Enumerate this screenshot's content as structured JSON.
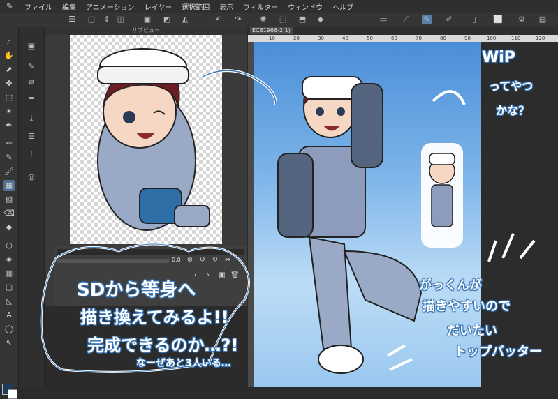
{
  "menu": {
    "logo_icon": "clip-studio-logo-icon",
    "items": [
      "ファイル",
      "編集",
      "アニメーション",
      "レイヤー",
      "選択範囲",
      "表示",
      "フィルター",
      "ウィンドウ",
      "ヘルプ"
    ]
  },
  "subview": {
    "title": "サブビュー",
    "zoom": "0.0"
  },
  "canvas": {
    "tab_label": "EC61966-2.1)",
    "ruler_ticks": [
      "10",
      "20",
      "30",
      "40",
      "50",
      "60",
      "70",
      "80",
      "90",
      "100",
      "110",
      "120"
    ]
  },
  "annotations": {
    "wip": "WiP",
    "wip_q1": "ってやつ",
    "wip_q2": "かな？",
    "left_1": "SDから等身へ",
    "left_2": "描き換えてみるよ!!",
    "left_3": "完成できるのか…?!",
    "left_4": "なーぜあと3人いる…",
    "right_1": "がっくんが",
    "right_2": "描きやすいので",
    "right_3": "だいたい",
    "right_4": "トップバッター"
  },
  "colors": {
    "main_color": "#1f3a5a",
    "sub_color": "#ffffff",
    "doodle_outline": "#3b78b8"
  }
}
